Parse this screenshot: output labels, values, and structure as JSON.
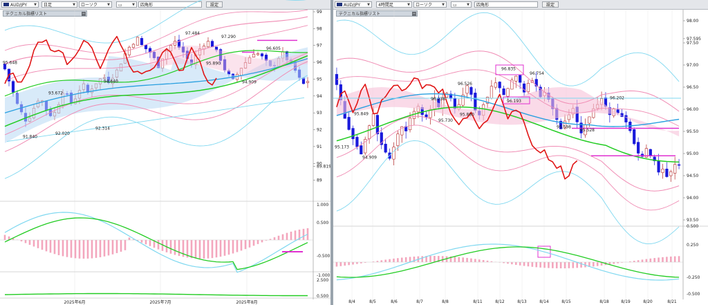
{
  "left": {
    "toolbar": {
      "symbol": "AUD/JPY",
      "timeframe": "日足",
      "chart_type": "ローソク",
      "draw_tool": "四角形",
      "settings_label": "設定"
    },
    "indicator_header": "テクニカル指標リスト",
    "price_axis": [
      "99",
      "98",
      "97",
      "96",
      "95",
      "94",
      "93",
      "92",
      "91",
      "90",
      "89.819",
      "89"
    ],
    "macd_axis": [
      "1.000",
      "0.500",
      "-0.500"
    ],
    "sub_axis": [
      "-1.000",
      "2.500",
      "0.500"
    ],
    "date_axis": [
      "2025年6月",
      "2025年7月",
      "2025年8月"
    ],
    "price_labels": [
      "95.648",
      "93.672",
      "94.640",
      "97.484",
      "97.290",
      "96.605",
      "95.890",
      "94.909",
      "91.840",
      "92.020",
      "92.314"
    ]
  },
  "right": {
    "toolbar": {
      "symbol": "AUD/JPY",
      "timeframe": "4時間足",
      "chart_type": "ローソク",
      "draw_tool": "四角形",
      "settings_label": "設定"
    },
    "indicator_header": "テクニカル指標リスト",
    "price_axis": [
      "98.00",
      "97.595",
      "97.50",
      "97.00",
      "96.50",
      "96.00",
      "95.50",
      "95.00",
      "94.50",
      "94.00",
      "93.50",
      "0.500",
      "0.250",
      "-0.250",
      "-0.500"
    ],
    "date_axis": [
      "8/4",
      "8/5",
      "8/6",
      "8/7",
      "8/8",
      "8/11",
      "8/12",
      "8/13",
      "8/14",
      "8/15",
      "8/18",
      "8/19",
      "8/20",
      "8/21"
    ],
    "price_labels": [
      "96.835",
      "96.754",
      "96.526",
      "96.238",
      "96.193",
      "95.849",
      "95.880",
      "95.730",
      "95.598",
      "95.528",
      "96.202",
      "95.173",
      "94.909"
    ]
  },
  "colors": {
    "bull": "#ffffff",
    "bear": "#1a1adb",
    "line_red": "#e01515",
    "line_green": "#22cc22",
    "line_blue": "#2aa0e0",
    "band_pink": "#f08cb4",
    "band_cyan": "#7fd8f0",
    "cloud_blue": "#b8d8f4",
    "cloud_pink": "#f6c2d8",
    "marker_magenta": "#e030d0",
    "toolbar_bg": "#e4e6ea"
  }
}
